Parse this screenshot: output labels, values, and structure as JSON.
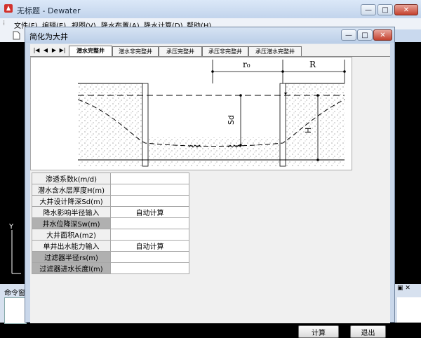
{
  "app": {
    "title": "无标题 - Dewater",
    "menu": [
      "文件(F)",
      "编辑(E)",
      "视图(V)",
      "降水布置(A)",
      "降水计算(D)",
      "帮助(H)"
    ],
    "window_buttons": {
      "minimize": "—",
      "maximize": "□",
      "close": "✕"
    },
    "axis_label": "Y",
    "command_label": "命令窗",
    "cmd_controls": "▣ ✕"
  },
  "dialog": {
    "title": "简化为大井",
    "window_buttons": {
      "minimize": "—",
      "maximize": "□",
      "close": "✕"
    },
    "tab_nav": [
      "|◀",
      "◀",
      "▶",
      "▶|"
    ],
    "tabs": [
      "潜水完整井",
      "潜水非完整井",
      "承压完整井",
      "承压非完整井",
      "承压潜水完整井"
    ],
    "active_tab": 0,
    "figure": {
      "r0": "r₀",
      "R": "R",
      "Sd": "Sd",
      "H": "H"
    },
    "params": [
      {
        "label": "渗透系数k(m/d)",
        "value": "",
        "shaded": false
      },
      {
        "label": "潜水含水层厚度H(m)",
        "value": "",
        "shaded": false
      },
      {
        "label": "大井设计降深Sd(m)",
        "value": "",
        "shaded": false
      },
      {
        "label": "降水影响半径输入",
        "value": "自动计算",
        "shaded": false
      },
      {
        "label": "井水位降深Sw(m)",
        "value": "",
        "shaded": true
      },
      {
        "label": "大井面积A(m2)",
        "value": "",
        "shaded": false
      },
      {
        "label": "单井出水能力输入",
        "value": "自动计算",
        "shaded": false
      },
      {
        "label": "过滤器半径rs(m)",
        "value": "",
        "shaded": true
      },
      {
        "label": "过滤器进水长度l(m)",
        "value": "",
        "shaded": true
      }
    ],
    "buttons": {
      "calculate": "计算",
      "exit": "退出"
    }
  },
  "colors": {
    "workspace": "#000000",
    "chrome": "#c9d9ee",
    "close_red": "#c4412e"
  }
}
